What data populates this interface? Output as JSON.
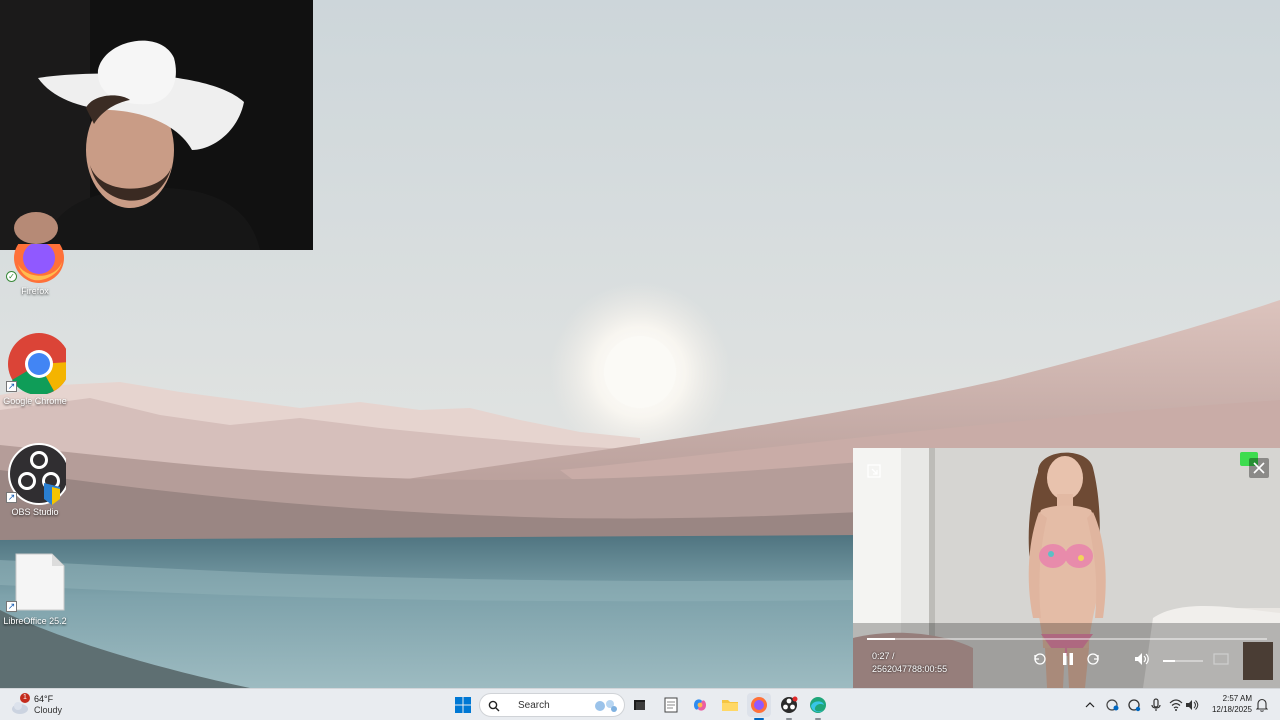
{
  "desktop": {
    "icons": [
      {
        "label": "Firefox",
        "icon": "firefox-icon"
      },
      {
        "label": "Google Chrome",
        "icon": "chrome-icon"
      },
      {
        "label": "OBS Studio",
        "icon": "obs-icon"
      },
      {
        "label": "LibreOffice 25.2",
        "icon": "document-icon"
      }
    ]
  },
  "pip_player": {
    "elapsed": "0:27 /",
    "stamp": "2562047788:00:55",
    "progress_fraction": 0.07,
    "volume_fraction": 0.3,
    "controls": [
      "resize-icon",
      "close-icon",
      "replay-icon",
      "pause-icon",
      "forward-icon",
      "volume-icon",
      "captions-icon"
    ]
  },
  "taskbar": {
    "weather": {
      "temp": "64°F",
      "condition": "Cloudy",
      "badge": "1"
    },
    "search_label": "Search",
    "pinned": [
      "windows-start-icon",
      "task-view-icon",
      "notepad-icon",
      "copilot-icon",
      "file-explorer-icon",
      "firefox-icon",
      "obs-icon",
      "edge-icon"
    ],
    "clock_time": "2:57 AM",
    "clock_date": "12/18/2025"
  },
  "colors": {
    "taskbar_bg": "#e9ecf0",
    "accent": "#0067c0"
  }
}
